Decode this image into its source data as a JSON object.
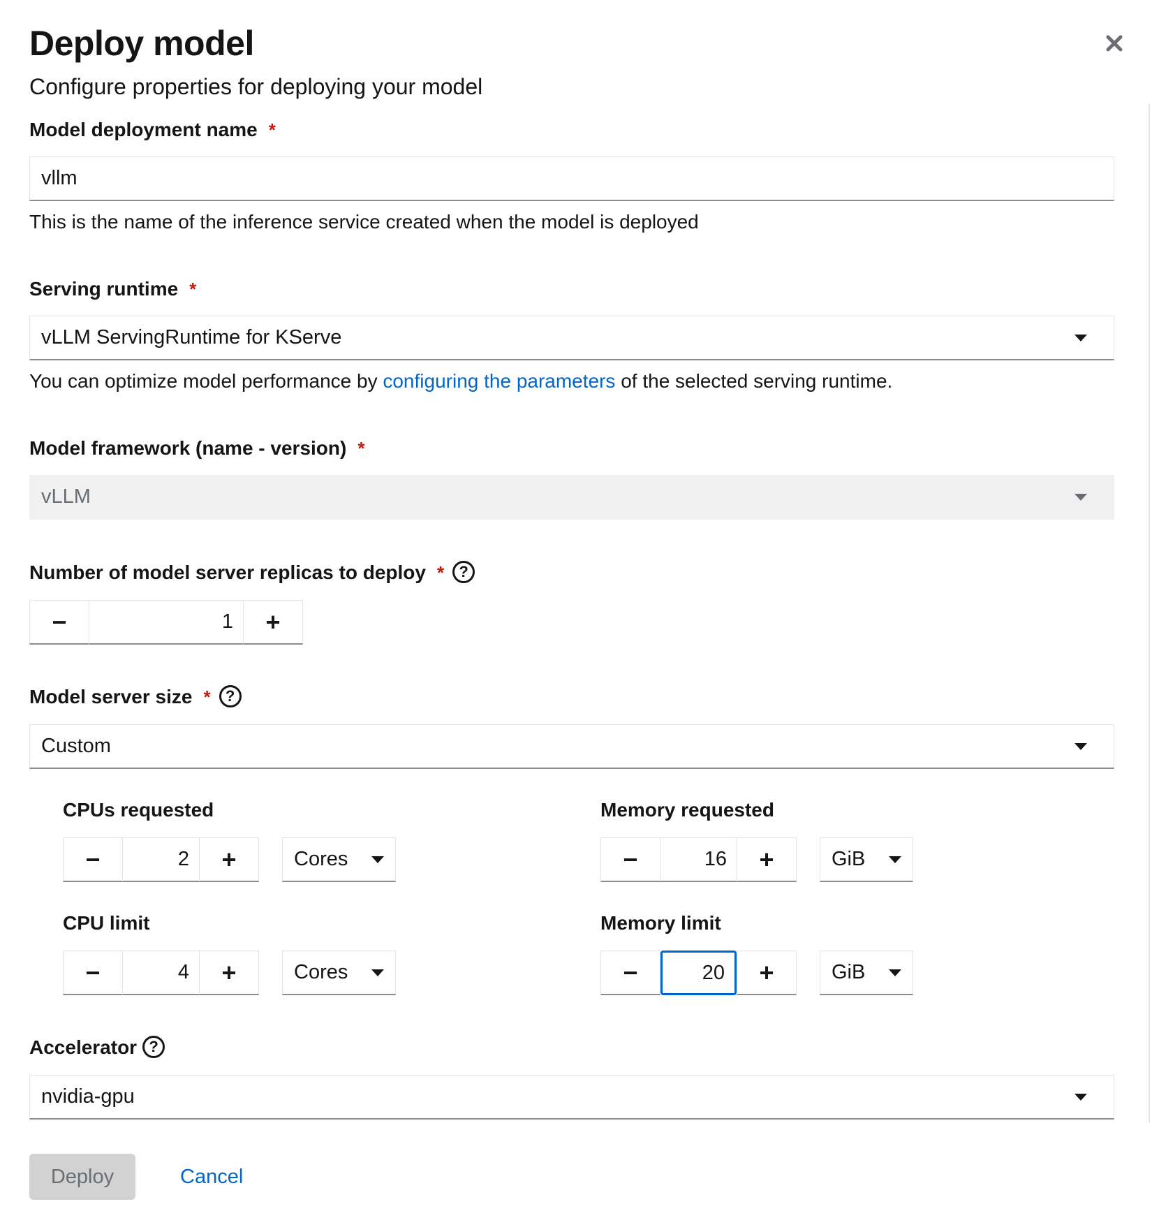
{
  "modal": {
    "title": "Deploy model",
    "subtitle": "Configure properties for deploying your model"
  },
  "deployment_name": {
    "label": "Model deployment name",
    "required_mark": "*",
    "value": "vllm",
    "helper": "This is the name of the inference service created when the model is deployed"
  },
  "serving_runtime": {
    "label": "Serving runtime",
    "required_mark": "*",
    "selected": "vLLM ServingRuntime for KServe",
    "helper_prefix": "You can optimize model performance by ",
    "helper_link": "configuring the parameters",
    "helper_suffix": " of the selected serving runtime."
  },
  "model_framework": {
    "label": "Model framework (name - version)",
    "required_mark": "*",
    "selected": "vLLM"
  },
  "replicas": {
    "label": "Number of model server replicas to deploy",
    "required_mark": "*",
    "help_glyph": "?",
    "value": "1",
    "minus": "−",
    "plus": "+"
  },
  "server_size": {
    "label": "Model server size",
    "required_mark": "*",
    "help_glyph": "?",
    "selected": "Custom"
  },
  "resources": {
    "cpus_requested": {
      "label": "CPUs requested",
      "value": "2",
      "unit": "Cores"
    },
    "cpu_limit": {
      "label": "CPU limit",
      "value": "4",
      "unit": "Cores"
    },
    "memory_requested": {
      "label": "Memory requested",
      "value": "16",
      "unit": "GiB"
    },
    "memory_limit": {
      "label": "Memory limit",
      "value": "20",
      "unit": "GiB"
    },
    "minus": "−",
    "plus": "+"
  },
  "accelerator": {
    "label": "Accelerator",
    "help_glyph": "?",
    "selected": "nvidia-gpu"
  },
  "footer": {
    "deploy_label": "Deploy",
    "cancel_label": "Cancel"
  },
  "colors": {
    "link": "#0066cc",
    "required": "#c9190b",
    "disabled_bg": "#f0f0f0",
    "focus": "#0066cc"
  }
}
